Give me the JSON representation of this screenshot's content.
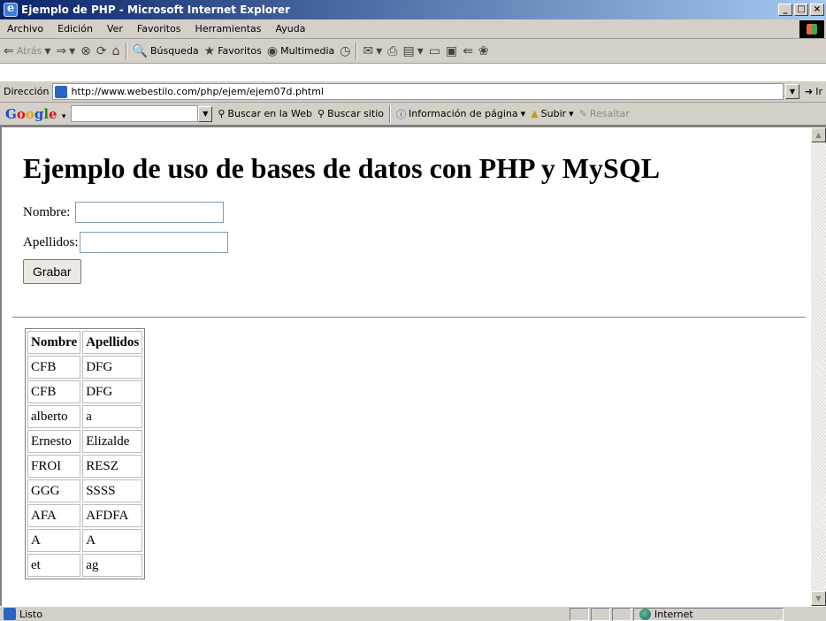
{
  "window": {
    "title": "Ejemplo de PHP - Microsoft Internet Explorer",
    "buttons": [
      "_",
      "□",
      "×"
    ]
  },
  "menubar": {
    "items": [
      "Archivo",
      "Edición",
      "Ver",
      "Favoritos",
      "Herramientas",
      "Ayuda"
    ]
  },
  "toolbar": {
    "back": "Atrás",
    "search": "Búsqueda",
    "favorites": "Favoritos",
    "multimedia": "Multimedia"
  },
  "address": {
    "label": "Dirección",
    "url": "http://www.webestilo.com/php/ejem/ejem07d.phtml",
    "go": "Ir"
  },
  "google": {
    "logo": [
      "G",
      "o",
      "o",
      "g",
      "l",
      "e"
    ],
    "search_web": "Buscar en la Web",
    "search_site": "Buscar sitio",
    "page_info": "Información de página",
    "up": "Subir",
    "highlight": "Resaltar"
  },
  "page": {
    "heading": "Ejemplo de uso de bases de datos con PHP y MySQL",
    "form": {
      "nombre_label": "Nombre:",
      "nombre_value": "",
      "apellidos_label": "Apellidos:",
      "apellidos_value": "",
      "submit_label": "Grabar"
    },
    "table": {
      "headers": [
        "Nombre",
        "Apellidos"
      ],
      "rows": [
        [
          "CFB",
          "DFG"
        ],
        [
          "CFB",
          "DFG"
        ],
        [
          "alberto",
          "a"
        ],
        [
          "Ernesto",
          "Elizalde"
        ],
        [
          "FROI",
          "RESZ"
        ],
        [
          "GGG",
          "SSSS"
        ],
        [
          "AFA",
          "AFDFA"
        ],
        [
          "A",
          "A"
        ],
        [
          "et",
          "ag"
        ]
      ]
    }
  },
  "statusbar": {
    "text": "Listo",
    "zone": "Internet"
  }
}
